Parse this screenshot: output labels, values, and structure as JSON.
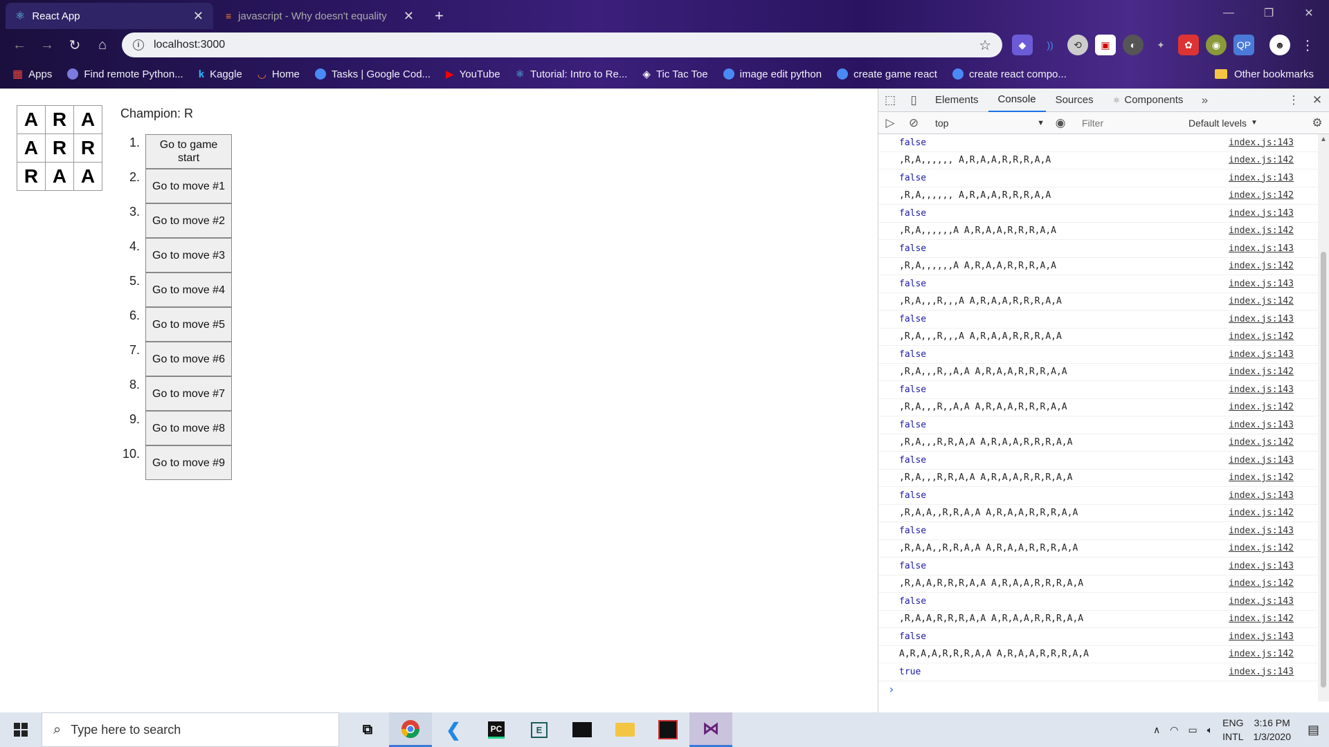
{
  "browser": {
    "tabs": [
      {
        "title": "React App",
        "active": true
      },
      {
        "title": "javascript - Why doesn't equality",
        "active": false
      }
    ],
    "url": "localhost:3000",
    "bookmarks": [
      {
        "label": "Apps",
        "color": "#e8453c"
      },
      {
        "label": "Find remote Python...",
        "color": "#7b7bdd"
      },
      {
        "label": "Kaggle",
        "color": "#20beff"
      },
      {
        "label": "Home",
        "color": "#ff7a30"
      },
      {
        "label": "Tasks | Google Cod...",
        "color": "#4a8af4"
      },
      {
        "label": "YouTube",
        "color": "#ff0000"
      },
      {
        "label": "Tutorial: Intro to Re...",
        "color": "#61dafb"
      },
      {
        "label": "Tic Tac Toe",
        "color": "#ffffff"
      },
      {
        "label": "image edit python",
        "color": "#4a8af4"
      },
      {
        "label": "create game react",
        "color": "#4a8af4"
      },
      {
        "label": "create react compo...",
        "color": "#4a8af4"
      }
    ],
    "other_bookmarks": "Other bookmarks"
  },
  "game": {
    "board": [
      [
        "A",
        "R",
        "A"
      ],
      [
        "A",
        "R",
        "R"
      ],
      [
        "R",
        "A",
        "A"
      ]
    ],
    "status": "Champion: R",
    "moves": [
      {
        "num": "1.",
        "label": "Go to game start"
      },
      {
        "num": "2.",
        "label": "Go to move #1"
      },
      {
        "num": "3.",
        "label": "Go to move #2"
      },
      {
        "num": "4.",
        "label": "Go to move #3"
      },
      {
        "num": "5.",
        "label": "Go to move #4"
      },
      {
        "num": "6.",
        "label": "Go to move #5"
      },
      {
        "num": "7.",
        "label": "Go to move #6"
      },
      {
        "num": "8.",
        "label": "Go to move #7"
      },
      {
        "num": "9.",
        "label": "Go to move #8"
      },
      {
        "num": "10.",
        "label": "Go to move #9"
      }
    ]
  },
  "devtools": {
    "tabs": [
      "Elements",
      "Console",
      "Sources",
      "Components"
    ],
    "active_tab": "Console",
    "context": "top",
    "filter_placeholder": "Filter",
    "levels": "Default levels",
    "logs": [
      {
        "msg": "false",
        "type": "bool",
        "src": "index.js:143"
      },
      {
        "msg": ",R,A,,,,,, A,R,A,A,R,R,R,A,A",
        "type": "text",
        "src": "index.js:142"
      },
      {
        "msg": "false",
        "type": "bool",
        "src": "index.js:143"
      },
      {
        "msg": ",R,A,,,,,, A,R,A,A,R,R,R,A,A",
        "type": "text",
        "src": "index.js:142"
      },
      {
        "msg": "false",
        "type": "bool",
        "src": "index.js:143"
      },
      {
        "msg": ",R,A,,,,,,A A,R,A,A,R,R,R,A,A",
        "type": "text",
        "src": "index.js:142"
      },
      {
        "msg": "false",
        "type": "bool",
        "src": "index.js:143"
      },
      {
        "msg": ",R,A,,,,,,A A,R,A,A,R,R,R,A,A",
        "type": "text",
        "src": "index.js:142"
      },
      {
        "msg": "false",
        "type": "bool",
        "src": "index.js:143"
      },
      {
        "msg": ",R,A,,,R,,,A A,R,A,A,R,R,R,A,A",
        "type": "text",
        "src": "index.js:142"
      },
      {
        "msg": "false",
        "type": "bool",
        "src": "index.js:143"
      },
      {
        "msg": ",R,A,,,R,,,A A,R,A,A,R,R,R,A,A",
        "type": "text",
        "src": "index.js:142"
      },
      {
        "msg": "false",
        "type": "bool",
        "src": "index.js:143"
      },
      {
        "msg": ",R,A,,,R,,A,A A,R,A,A,R,R,R,A,A",
        "type": "text",
        "src": "index.js:142"
      },
      {
        "msg": "false",
        "type": "bool",
        "src": "index.js:143"
      },
      {
        "msg": ",R,A,,,R,,A,A A,R,A,A,R,R,R,A,A",
        "type": "text",
        "src": "index.js:142"
      },
      {
        "msg": "false",
        "type": "bool",
        "src": "index.js:143"
      },
      {
        "msg": ",R,A,,,R,R,A,A A,R,A,A,R,R,R,A,A",
        "type": "text",
        "src": "index.js:142"
      },
      {
        "msg": "false",
        "type": "bool",
        "src": "index.js:143"
      },
      {
        "msg": ",R,A,,,R,R,A,A A,R,A,A,R,R,R,A,A",
        "type": "text",
        "src": "index.js:142"
      },
      {
        "msg": "false",
        "type": "bool",
        "src": "index.js:143"
      },
      {
        "msg": ",R,A,A,,R,R,A,A A,R,A,A,R,R,R,A,A",
        "type": "text",
        "src": "index.js:142"
      },
      {
        "msg": "false",
        "type": "bool",
        "src": "index.js:143"
      },
      {
        "msg": ",R,A,A,,R,R,A,A A,R,A,A,R,R,R,A,A",
        "type": "text",
        "src": "index.js:142"
      },
      {
        "msg": "false",
        "type": "bool",
        "src": "index.js:143"
      },
      {
        "msg": ",R,A,A,R,R,R,A,A A,R,A,A,R,R,R,A,A",
        "type": "text",
        "src": "index.js:142"
      },
      {
        "msg": "false",
        "type": "bool",
        "src": "index.js:143"
      },
      {
        "msg": ",R,A,A,R,R,R,A,A A,R,A,A,R,R,R,A,A",
        "type": "text",
        "src": "index.js:142"
      },
      {
        "msg": "false",
        "type": "bool",
        "src": "index.js:143"
      },
      {
        "msg": "A,R,A,A,R,R,R,A,A A,R,A,A,R,R,R,A,A",
        "type": "text",
        "src": "index.js:142"
      },
      {
        "msg": "true",
        "type": "bool",
        "src": "index.js:143"
      }
    ]
  },
  "taskbar": {
    "search_placeholder": "Type here to search",
    "lang_top": "ENG",
    "lang_bottom": "INTL",
    "time": "3:16 PM",
    "date": "1/3/2020"
  }
}
